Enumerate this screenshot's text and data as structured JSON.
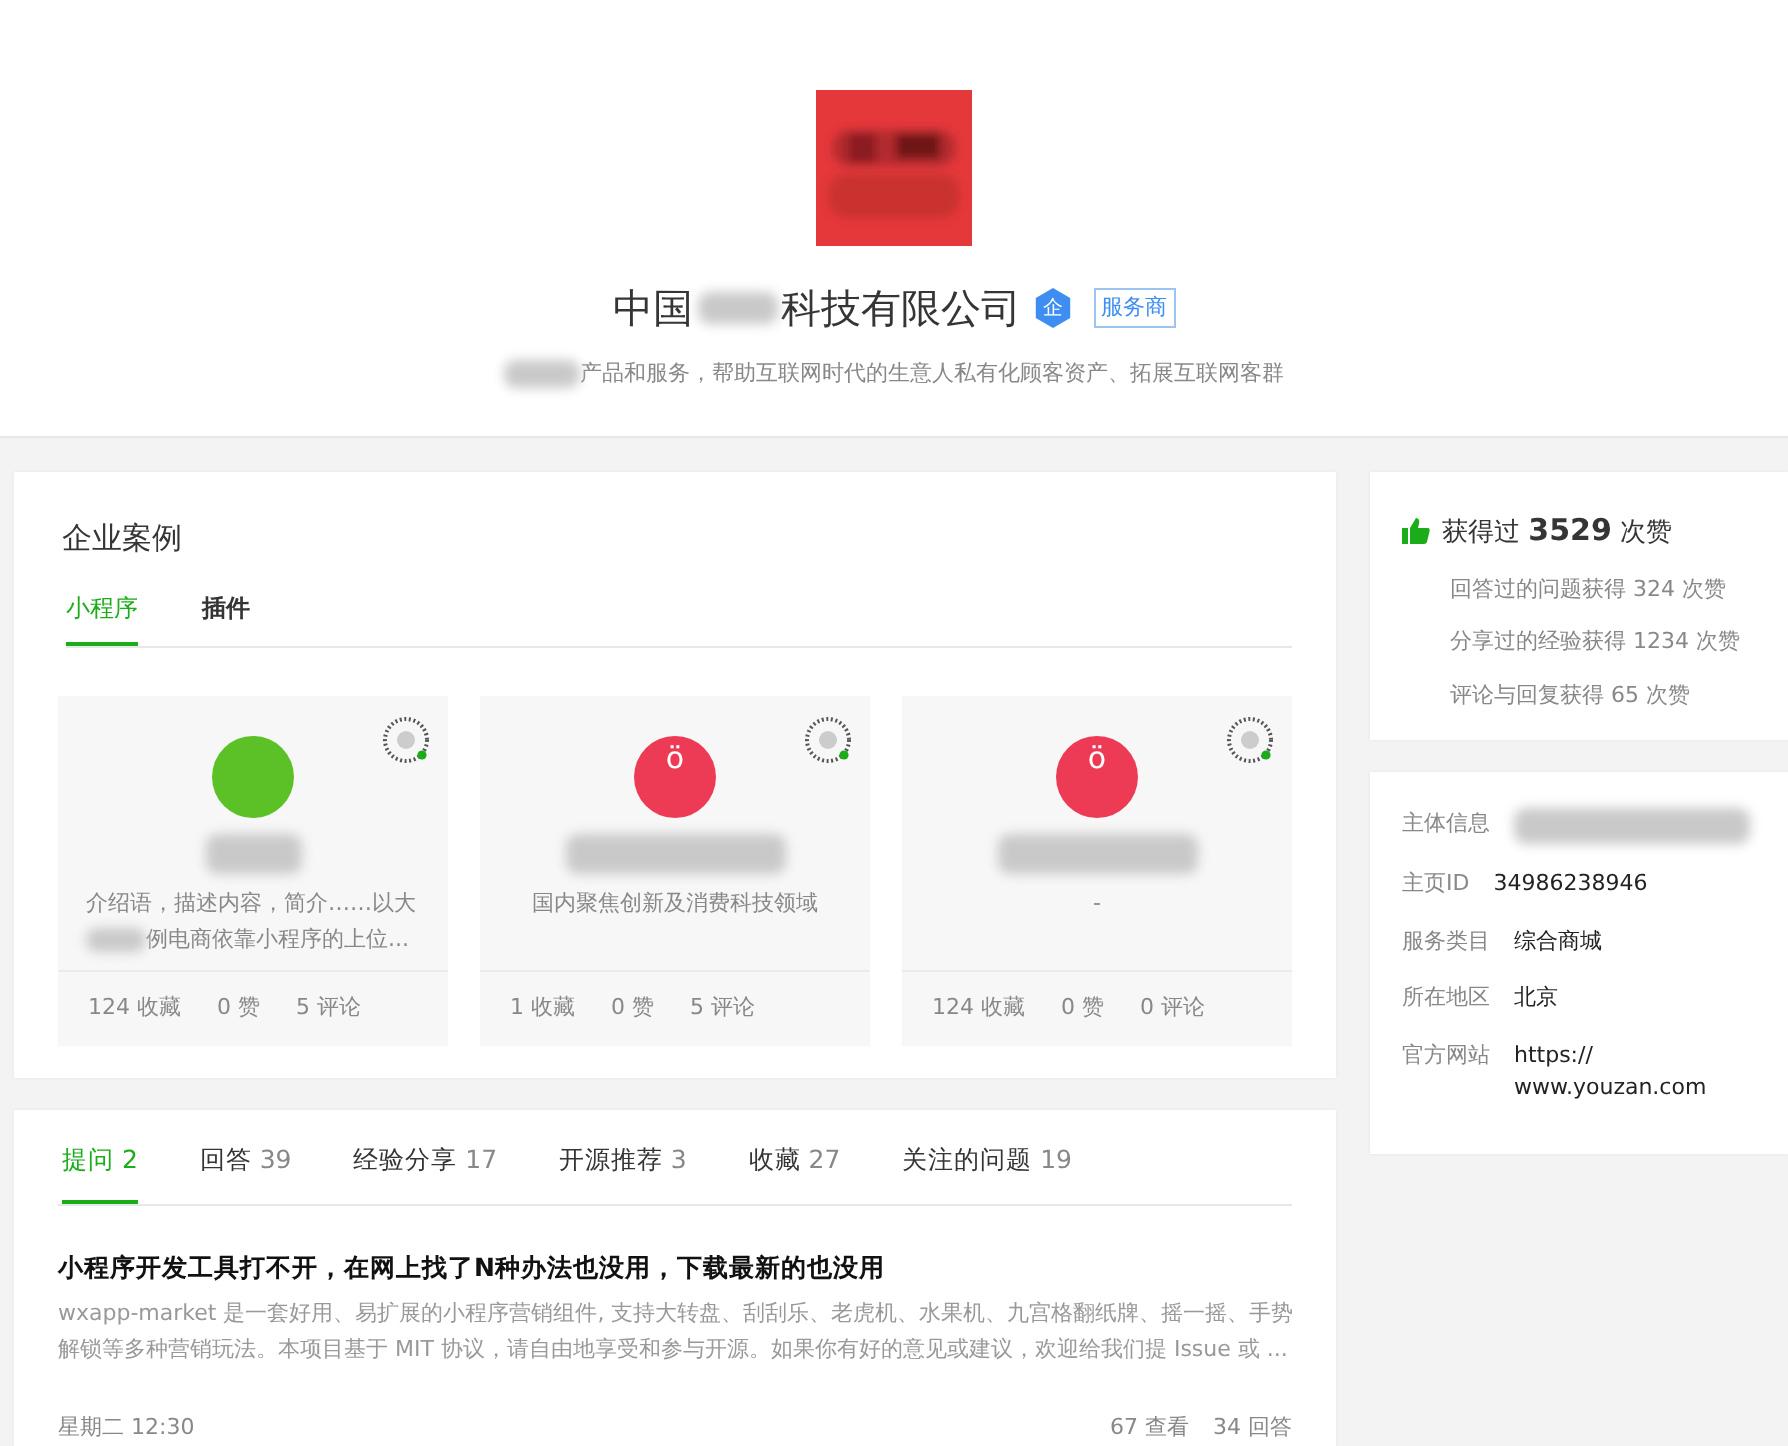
{
  "profile": {
    "name_start": "中国",
    "name_redacted": true,
    "name_end": "科技有限公司",
    "verified_icon": "企",
    "badge": "服务商",
    "intro_redacted": true,
    "intro": "产品和服务，帮助互联网时代的生意人私有化顾客资产、拓展互联网客群"
  },
  "cases": {
    "title": "企业案例",
    "tabs": [
      {
        "label": "小程序",
        "selected": true
      },
      {
        "label": "插件",
        "selected": false
      }
    ],
    "items": [
      {
        "color": "#5cc126",
        "name_redacted": true,
        "description": [
          {
            "text": "介绍语，描述内容，简介……以大",
            "redacted_before": false
          },
          {
            "text": "例电商依靠小程序的上位...",
            "redacted_before": true
          }
        ],
        "stats": [
          "124 收藏",
          "0 赞",
          "5 评论"
        ]
      },
      {
        "color": "#ee3b55",
        "avatar_text": "ö",
        "name_redacted": true,
        "description": [
          {
            "text": "国内聚焦创新及消费科技领域",
            "redacted_before": false
          }
        ],
        "stats": [
          "1 收藏",
          "0 赞",
          "5 评论"
        ]
      },
      {
        "color": "#ee3b55",
        "avatar_text": "ö",
        "name_redacted": true,
        "description": [
          {
            "text": "-",
            "redacted_before": false
          }
        ],
        "stats": [
          "124 收藏",
          "0 赞",
          "0 评论"
        ]
      }
    ]
  },
  "likes": {
    "prefix": "获得过",
    "count": "3529",
    "suffix": "次赞",
    "details": [
      "回答过的问题获得 324 次赞",
      "分享过的经验获得 1234 次赞",
      "评论与回复获得 65 次赞"
    ]
  },
  "info": [
    {
      "label": "主体信息",
      "redacted": true
    },
    {
      "label": "主页ID",
      "value": "34986238946",
      "redacted": false
    },
    {
      "label": "服务类目",
      "value": "综合商城",
      "redacted": false
    },
    {
      "label": "所在地区",
      "value": "北京",
      "redacted": false
    },
    {
      "label": "官方网站",
      "value": "https:// www.youzan.com",
      "redacted": false
    }
  ],
  "activity": {
    "tabs": [
      {
        "label": "提问",
        "count": "2",
        "selected": true
      },
      {
        "label": "回答",
        "count": "39",
        "selected": false
      },
      {
        "label": "经验分享",
        "count": "17",
        "selected": false
      },
      {
        "label": "开源推荐",
        "count": "3",
        "selected": false
      },
      {
        "label": "收藏",
        "count": "27",
        "selected": false
      },
      {
        "label": "关注的问题",
        "count": "19",
        "selected": false
      }
    ],
    "post": {
      "title": "小程序开发工具打不开，在网上找了N种办法也没用，下载最新的也没用",
      "excerpt": [
        "wxapp-market 是一套好用、易扩展的小程序营销组件, 支持大转盘、刮刮乐、老虎机、水果机、九宫格翻纸牌、摇一摇、手势",
        "解锁等多种营销玩法。本项目基于 MIT 协议，请自由地享受和参与开源。如果你有好的意见或建议，欢迎给我们提 Issue 或 ..."
      ],
      "time": "星期二 12:30",
      "stats": [
        "67 查看",
        "34 回答"
      ]
    }
  }
}
